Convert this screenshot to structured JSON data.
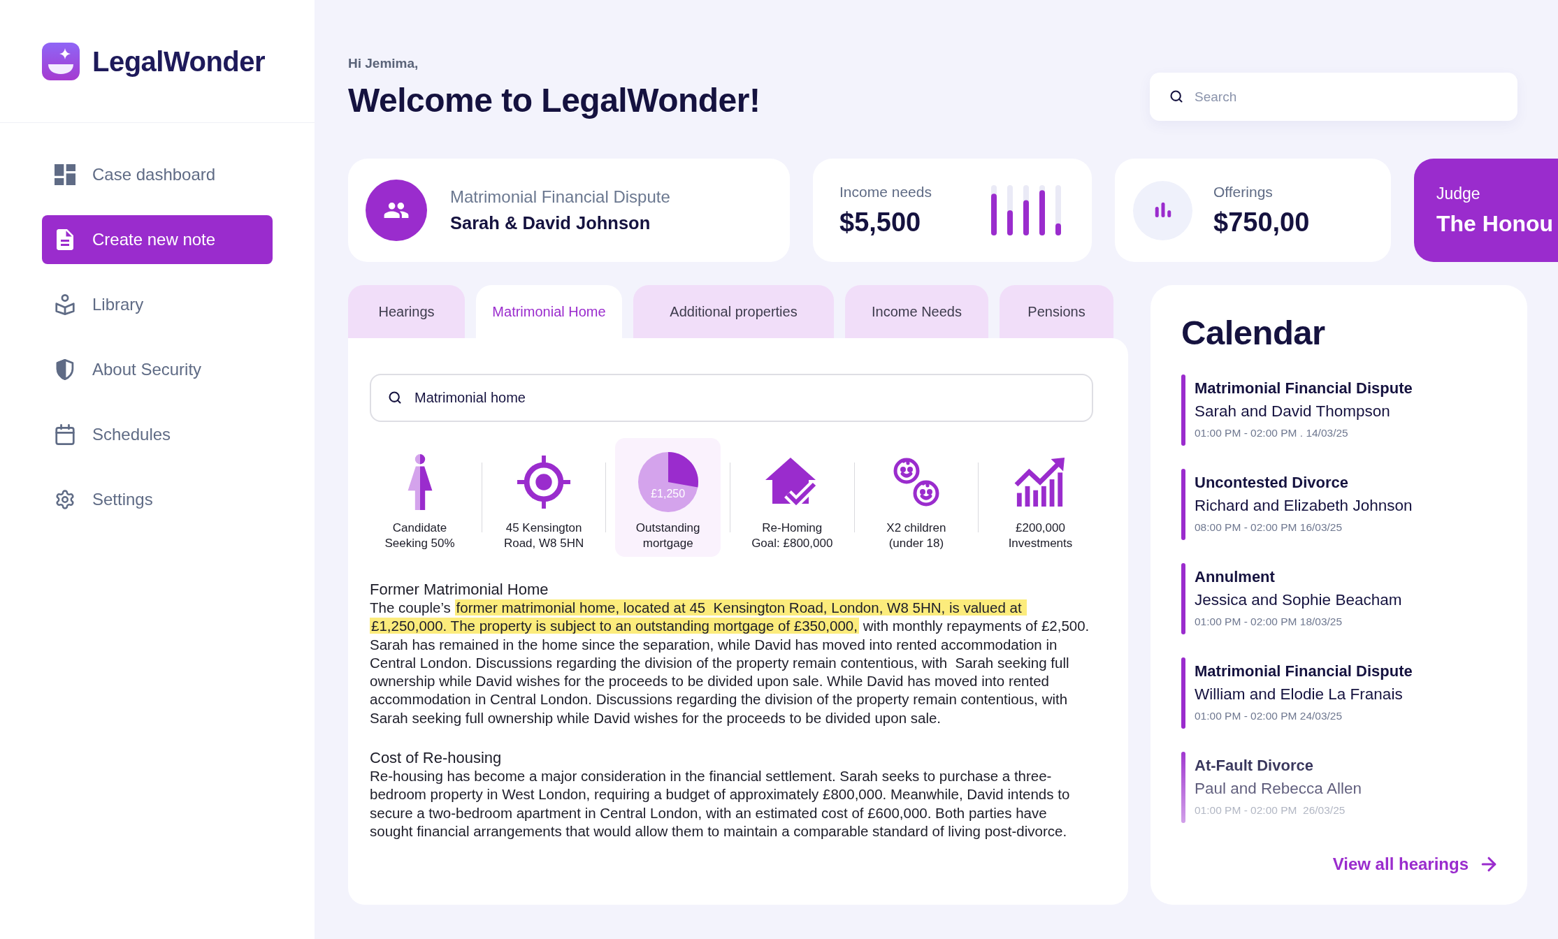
{
  "sidebar": {
    "logo": "LegalWonder",
    "items": [
      {
        "label": "Case dashboard",
        "selected": false
      },
      {
        "label": "Create new note",
        "selected": true
      },
      {
        "label": "Library",
        "selected": false
      },
      {
        "label": "About Security",
        "selected": false
      },
      {
        "label": "Schedules",
        "selected": false
      },
      {
        "label": "Settings",
        "selected": false
      }
    ]
  },
  "header": {
    "greeting": "Hi Jemima,",
    "title": "Welcome to LegalWonder!",
    "search": {
      "placeholder": "Search"
    }
  },
  "case_card": {
    "label": "Matrimonial Financial Dispute",
    "parties": "Sarah & David Johnson"
  },
  "income_card": {
    "label": "Income needs",
    "value": "$5,500"
  },
  "offerings_card": {
    "label": "Offerings",
    "value": "$750,00"
  },
  "judge_card": {
    "label": "Judge",
    "value": "The Honou"
  },
  "tabs": [
    {
      "label": "Hearings",
      "selected": false
    },
    {
      "label": "Matrimonial Home",
      "selected": true
    },
    {
      "label": "Additional properties",
      "selected": false
    },
    {
      "label": "Income Needs",
      "selected": false
    },
    {
      "label": "Pensions",
      "selected": false
    }
  ],
  "panel": {
    "search": {
      "value": "Matrimonial home"
    },
    "tiles": [
      {
        "lines": [
          "Candidate",
          "Seeking 50%"
        ],
        "selected": false
      },
      {
        "lines": [
          "45 Kensington",
          "Road, W8 5HN"
        ],
        "selected": false
      },
      {
        "value": "£1,250",
        "lines": [
          "Outstanding",
          "mortgage"
        ],
        "selected": true
      },
      {
        "lines": [
          "Re-Homing",
          "Goal: £800,000"
        ],
        "selected": false
      },
      {
        "lines": [
          "X2 children",
          "(under 18)"
        ],
        "selected": false
      },
      {
        "lines": [
          "£200,000",
          "Investments"
        ],
        "selected": false
      }
    ],
    "sections": [
      {
        "heading": "Former Matrimonial Home",
        "segments": [
          {
            "text": "The couple’s ",
            "highlighted": false
          },
          {
            "text": "former matrimonial home, located at 45  Kensington Road, London, W8 5HN, is valued at £1,250,000. The property is subject to an outstanding mortgage of £350,000,",
            "highlighted": true
          },
          {
            "text": " with monthly repayments of £2,500. Sarah has remained in the home since the separation, while David has moved into rented accommodation in Central London. Discussions regarding the division of the property remain contentious, with  Sarah seeking full ownership while David wishes for the proceeds to be divided upon sale. While David has moved into rented accommodation in Central London. Discussions regarding the division of the property remain contentious, with Sarah seeking full ownership while David wishes for the proceeds to be divided upon sale.",
            "highlighted": false
          }
        ]
      },
      {
        "heading": "Cost of Re-housing",
        "segments": [
          {
            "text": "Re-housing has become a major consideration in the financial settlement. Sarah seeks to purchase a three-bedroom property in West London, requiring a budget of approximately £800,000. Meanwhile, David intends to secure a two-bedroom apartment in Central London, with an estimated cost of £600,000. Both parties have sought financial arrangements that would allow them to maintain a comparable standard of living post-divorce.",
            "highlighted": false
          }
        ]
      }
    ]
  },
  "calendar": {
    "title": "Calendar",
    "events": [
      {
        "title": "Matrimonial Financial Dispute",
        "parties": "Sarah and David Thompson",
        "time": "01:00 PM - 02:00 PM . 14/03/25"
      },
      {
        "title": "Uncontested Divorce",
        "parties": "Richard and Elizabeth Johnson",
        "time": "08:00 PM - 02:00 PM 16/03/25"
      },
      {
        "title": "Annulment",
        "parties": "Jessica and Sophie Beacham",
        "time": "01:00 PM - 02:00 PM 18/03/25"
      },
      {
        "title": "Matrimonial Financial Dispute",
        "parties": "William and Elodie La Franais",
        "time": "01:00 PM - 02:00 PM 24/03/25"
      },
      {
        "title": "At-Fault Divorce",
        "parties": "Paul and Rebecca Allen",
        "time": "01:00 PM - 02:00 PM  26/03/25"
      }
    ],
    "link": "View all hearings"
  }
}
